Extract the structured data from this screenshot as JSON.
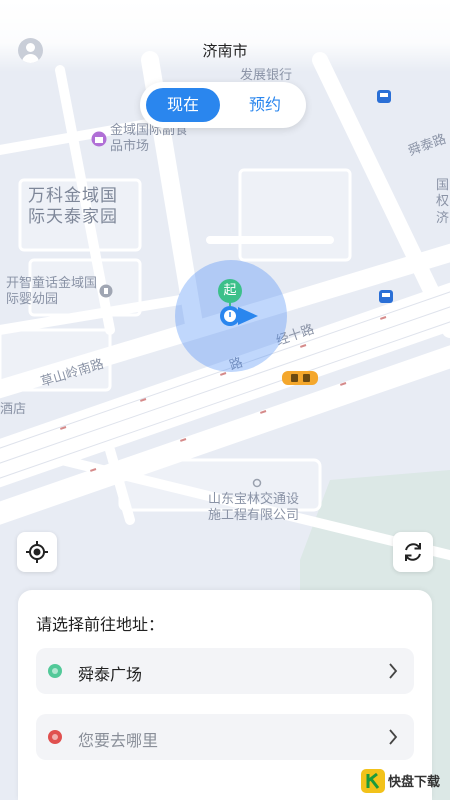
{
  "header": {
    "city": "济南市"
  },
  "mode_toggle": {
    "now_label": "现在",
    "reserve_label": "预约"
  },
  "map": {
    "pickup_marker_label": "起",
    "labels": {
      "bank": "发展银行",
      "market": "金域国际副食品市场",
      "vanke": "万科金域国际天泰家园",
      "kindergarten": "开智童话金域国际婴幼园",
      "caoshan": "草山岭南路",
      "jingshi": "经十路",
      "jingshi_partial": "路",
      "shuntai_road": "舜泰路",
      "company": "山东宝林交通设施工程有限公司",
      "hotel": "酒店",
      "right_edge": "国权济"
    }
  },
  "card": {
    "title": "请选择前往地址：",
    "start_place": "舜泰广场",
    "destination_placeholder": "您要去哪里"
  },
  "colors": {
    "accent": "#2a86ee",
    "start_dot": "#52c999",
    "dest_dot": "#e0504f",
    "pickup_marker": "#3cc08a",
    "taxi": "#f4a72c"
  },
  "watermark": {
    "text": "快盘下载"
  },
  "icons": {
    "avatar": "user-avatar-icon",
    "locate": "crosshair-icon",
    "refresh": "refresh-icon",
    "chevron": "chevron-right-icon"
  }
}
